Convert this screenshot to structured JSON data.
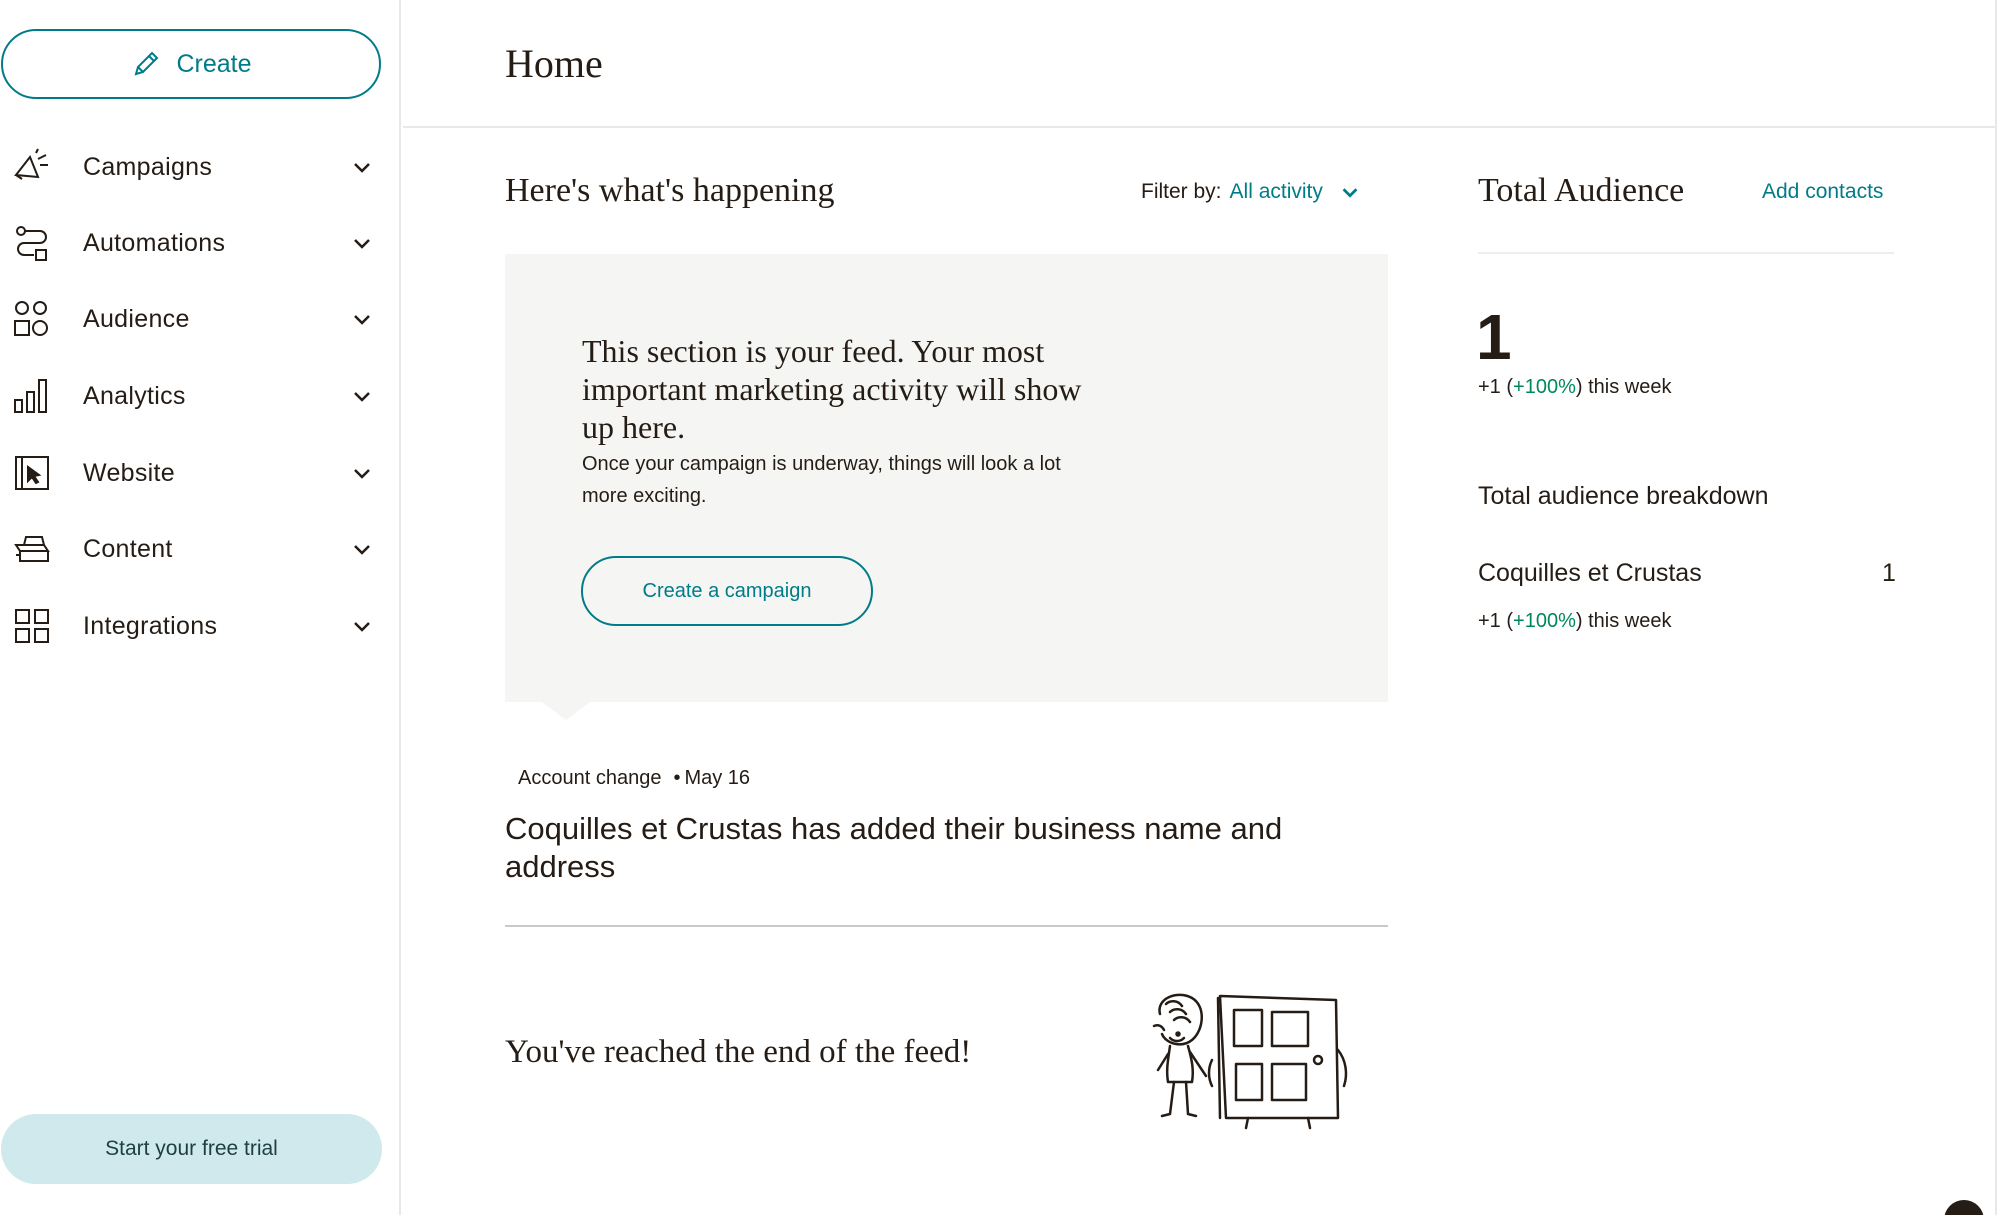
{
  "sidebar": {
    "create_label": "Create",
    "items": [
      {
        "label": "Campaigns",
        "icon": "megaphone-icon"
      },
      {
        "label": "Automations",
        "icon": "automation-flow-icon"
      },
      {
        "label": "Audience",
        "icon": "audience-people-icon"
      },
      {
        "label": "Analytics",
        "icon": "bar-chart-icon"
      },
      {
        "label": "Website",
        "icon": "website-cursor-icon"
      },
      {
        "label": "Content",
        "icon": "content-stack-icon"
      },
      {
        "label": "Integrations",
        "icon": "grid-icon"
      }
    ],
    "trial_label": "Start your free trial"
  },
  "header": {
    "title": "Home"
  },
  "feed": {
    "title": "Here's what's happening",
    "filter_label": "Filter by:",
    "filter_value": "All activity",
    "empty": {
      "heading": "This section is your feed. Your most important marketing activity will show up here.",
      "subtext": "Once your campaign is underway, things will look a lot more exciting.",
      "button": "Create a campaign"
    },
    "event": {
      "type": "Account change",
      "date": "May 16",
      "text": "Coquilles et Crustas has added their business name and address"
    },
    "end_text": "You've reached the end of the feed!"
  },
  "audience": {
    "title": "Total Audience",
    "add_contacts": "Add contacts",
    "count": "1",
    "delta_prefix": "+1 (",
    "delta_pct": "+100%",
    "delta_suffix": ") this week",
    "breakdown_title": "Total audience breakdown",
    "breakdown": [
      {
        "name": "Coquilles et Crustas",
        "value": "1",
        "delta_prefix": "+1 (",
        "delta_pct": "+100%",
        "delta_suffix": ") this week"
      }
    ]
  },
  "colors": {
    "accent": "#007c89",
    "positive": "#00885d",
    "trial_bg": "#cfe9ec",
    "card_bg": "#f5f5f3"
  }
}
